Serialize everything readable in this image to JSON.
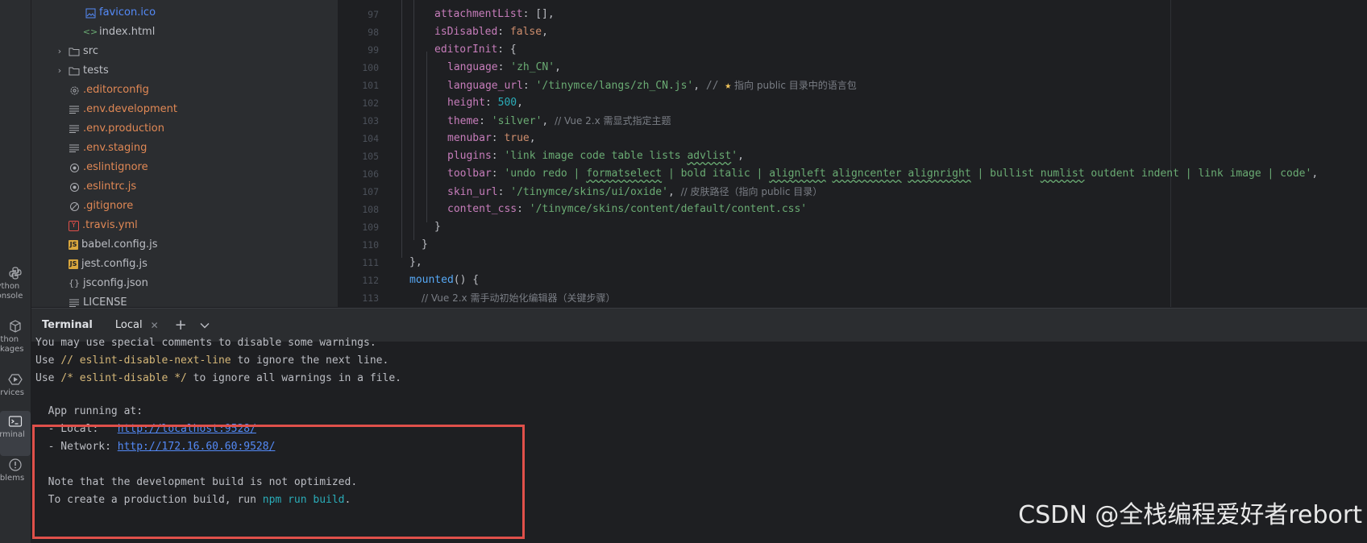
{
  "tool_window_bar": {
    "items": [
      {
        "label": "ython\nonsole",
        "icon": "python-console-icon",
        "active": false
      },
      {
        "label": "ython\nckages",
        "icon": "python-packages-icon",
        "active": false
      },
      {
        "label": "ervices",
        "icon": "services-icon",
        "active": false
      },
      {
        "label": "erminal",
        "icon": "terminal-icon",
        "active": true
      },
      {
        "label": "oblems",
        "icon": "problems-icon",
        "active": false
      }
    ]
  },
  "project_tree": {
    "items": [
      {
        "name": "favicon.ico",
        "icon": "image-file-icon",
        "color": "#548af7",
        "expandable": false
      },
      {
        "name": "index.html",
        "icon": "html-file-icon",
        "color": "#bcbec4",
        "expandable": false
      },
      {
        "name": "src",
        "icon": "folder-icon",
        "color": "#bcbec4",
        "expandable": true
      },
      {
        "name": "tests",
        "icon": "folder-icon",
        "color": "#bcbec4",
        "expandable": true
      },
      {
        "name": ".editorconfig",
        "icon": "gear-file-icon",
        "color": "#e08855",
        "expandable": false
      },
      {
        "name": ".env.development",
        "icon": "text-file-icon",
        "color": "#e08855",
        "expandable": false
      },
      {
        "name": ".env.production",
        "icon": "text-file-icon",
        "color": "#e08855",
        "expandable": false
      },
      {
        "name": ".env.staging",
        "icon": "text-file-icon",
        "color": "#e08855",
        "expandable": false
      },
      {
        "name": ".eslintignore",
        "icon": "eslint-file-icon",
        "color": "#e08855",
        "expandable": false
      },
      {
        "name": ".eslintrc.js",
        "icon": "eslint-file-icon",
        "color": "#e08855",
        "expandable": false
      },
      {
        "name": ".gitignore",
        "icon": "ignore-file-icon",
        "color": "#e08855",
        "expandable": false
      },
      {
        "name": ".travis.yml",
        "icon": "yaml-file-icon",
        "color": "#e08855",
        "expandable": false
      },
      {
        "name": "babel.config.js",
        "icon": "js-file-icon",
        "color": "#bcbec4",
        "expandable": false
      },
      {
        "name": "jest.config.js",
        "icon": "js-file-icon",
        "color": "#bcbec4",
        "expandable": false
      },
      {
        "name": "jsconfig.json",
        "icon": "json-file-icon",
        "color": "#bcbec4",
        "expandable": false
      },
      {
        "name": "LICENSE",
        "icon": "text-file-icon",
        "color": "#bcbec4",
        "expandable": false
      }
    ]
  },
  "editor": {
    "line_numbers": [
      "97",
      "98",
      "99",
      "100",
      "101",
      "102",
      "103",
      "104",
      "105",
      "106",
      "107",
      "108",
      "109",
      "110",
      "111",
      "112",
      "113"
    ],
    "code": {
      "l97_key": "attachmentList",
      "l97_rest": ": [],",
      "l98_key": "isDisabled",
      "l98_colon": ": ",
      "l98_val": "false",
      "l98_comma": ",",
      "l99_key": "editorInit",
      "l99_rest": ": {",
      "l100_key": "language",
      "l100_colon": ": ",
      "l100_val": "'zh_CN'",
      "l100_comma": ",",
      "l101_key": "language_url",
      "l101_colon": ": ",
      "l101_val": "'/tinymce/langs/zh_CN.js'",
      "l101_comma": ", ",
      "l101_comment1": "// ",
      "l101_star": "★",
      "l101_comment2": " 指向 public 目录中的语言包",
      "l102_key": "height",
      "l102_colon": ": ",
      "l102_val": "500",
      "l102_comma": ",",
      "l103_key": "theme",
      "l103_colon": ": ",
      "l103_val": "'silver'",
      "l103_comma": ", ",
      "l103_comment": "// Vue 2.x 需显式指定主题",
      "l104_key": "menubar",
      "l104_colon": ": ",
      "l104_val": "true",
      "l104_comma": ",",
      "l105_key": "plugins",
      "l105_colon": ": ",
      "l105_val_a": "'link image code table lists ",
      "l105_val_b": "advlist",
      "l105_val_c": "'",
      "l105_comma": ",",
      "l106_key": "toolbar",
      "l106_colon": ": ",
      "l106_val_a": "'undo redo | ",
      "l106_val_b": "formatselect",
      "l106_val_c": " | bold italic | ",
      "l106_val_d": "alignleft",
      "l106_val_e": " ",
      "l106_val_f": "aligncenter",
      "l106_val_g": " ",
      "l106_val_h": "alignright",
      "l106_val_i": " | bullist ",
      "l106_val_j": "numlist",
      "l106_val_k": " outdent indent | link image | code'",
      "l106_comma": ",",
      "l107_key": "skin_url",
      "l107_colon": ": ",
      "l107_val": "'/tinymce/skins/ui/oxide'",
      "l107_comma": ", ",
      "l107_comment": "// 皮肤路径（指向 public 目录）",
      "l108_key": "content_css",
      "l108_colon": ": ",
      "l108_val": "'/tinymce/skins/content/default/content.css'",
      "l109": "}",
      "l110": "}",
      "l111": "},",
      "l112_fn": "mounted",
      "l112_rest": "() {",
      "l113_comment": "// Vue 2.x 需手动初始化编辑器（关键步骤）"
    }
  },
  "terminal": {
    "title": "Terminal",
    "tab_label": "Local",
    "lines": {
      "t1": "You may use special comments to disable some warnings.",
      "t2_a": "Use ",
      "t2_b": "// eslint-disable-next-line",
      "t2_c": " to ignore the next line.",
      "t3_a": "Use ",
      "t3_b": "/* eslint-disable */",
      "t3_c": " to ignore all warnings in a file.",
      "t4": "  App running at:",
      "t5_a": "  - Local:   ",
      "t5_b": "http://localhost:9528/",
      "t6_a": "  - Network: ",
      "t6_b": "http://172.16.60.60:9528/",
      "t7": "  Note that the development build is not optimized.",
      "t8_a": "  To create a production build, run ",
      "t8_b": "npm run build",
      "t8_c": "."
    },
    "highlight_color": "#e0504a"
  },
  "watermark": "CSDN @全栈编程爱好者rebort"
}
